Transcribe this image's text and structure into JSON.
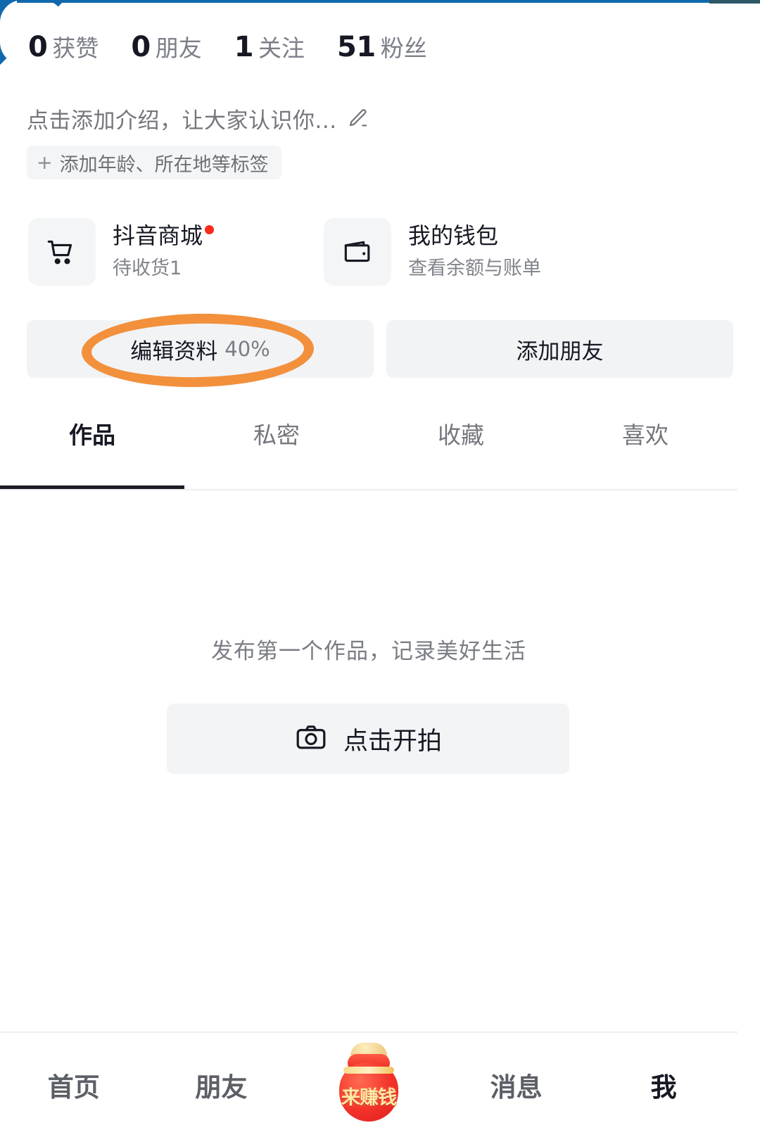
{
  "stats": [
    {
      "num": "0",
      "label": "获赞",
      "name": "likes"
    },
    {
      "num": "0",
      "label": "朋友",
      "name": "friends"
    },
    {
      "num": "1",
      "label": "关注",
      "name": "following"
    },
    {
      "num": "51",
      "label": "粉丝",
      "name": "followers"
    }
  ],
  "bio": {
    "text": "点击添加介绍，让大家认识你...",
    "edit_icon": "pencil-icon"
  },
  "tag_chip": {
    "plus": "+",
    "label": "添加年龄、所在地等标签"
  },
  "entries": [
    {
      "icon": "shopping-cart-icon",
      "title": "抖音商城",
      "subtitle": "待收货1",
      "has_badge": true
    },
    {
      "icon": "wallet-icon",
      "title": "我的钱包",
      "subtitle": "查看余额与账单",
      "has_badge": false
    }
  ],
  "actions": {
    "edit_profile_label": "编辑资料",
    "edit_profile_percent": "40%",
    "add_friend_label": "添加朋友"
  },
  "annotation": {
    "shape": "ellipse-highlight",
    "color": "#f2903c",
    "target": "编辑资料 40%"
  },
  "tabs": [
    {
      "label": "作品",
      "active": true
    },
    {
      "label": "私密",
      "active": false
    },
    {
      "label": "收藏",
      "active": false
    },
    {
      "label": "喜欢",
      "active": false
    }
  ],
  "empty_state": {
    "message": "发布第一个作品，记录美好生活",
    "button_label": "点击开拍",
    "button_icon": "camera-icon"
  },
  "bottom_nav": [
    {
      "label": "首页",
      "active": false,
      "icon": ""
    },
    {
      "label": "朋友",
      "active": false,
      "icon": ""
    },
    {
      "label": "来赚钱",
      "active": false,
      "icon": "money-bag-icon"
    },
    {
      "label": "消息",
      "active": false,
      "icon": ""
    },
    {
      "label": "我",
      "active": true,
      "icon": ""
    }
  ],
  "colors": {
    "accent_orange": "#f2903c",
    "badge_red": "#fa2c19",
    "text_primary": "#161823",
    "text_secondary": "#7a7d85",
    "chip_bg": "#f2f3f5",
    "frame_blue": "#1069ad"
  }
}
